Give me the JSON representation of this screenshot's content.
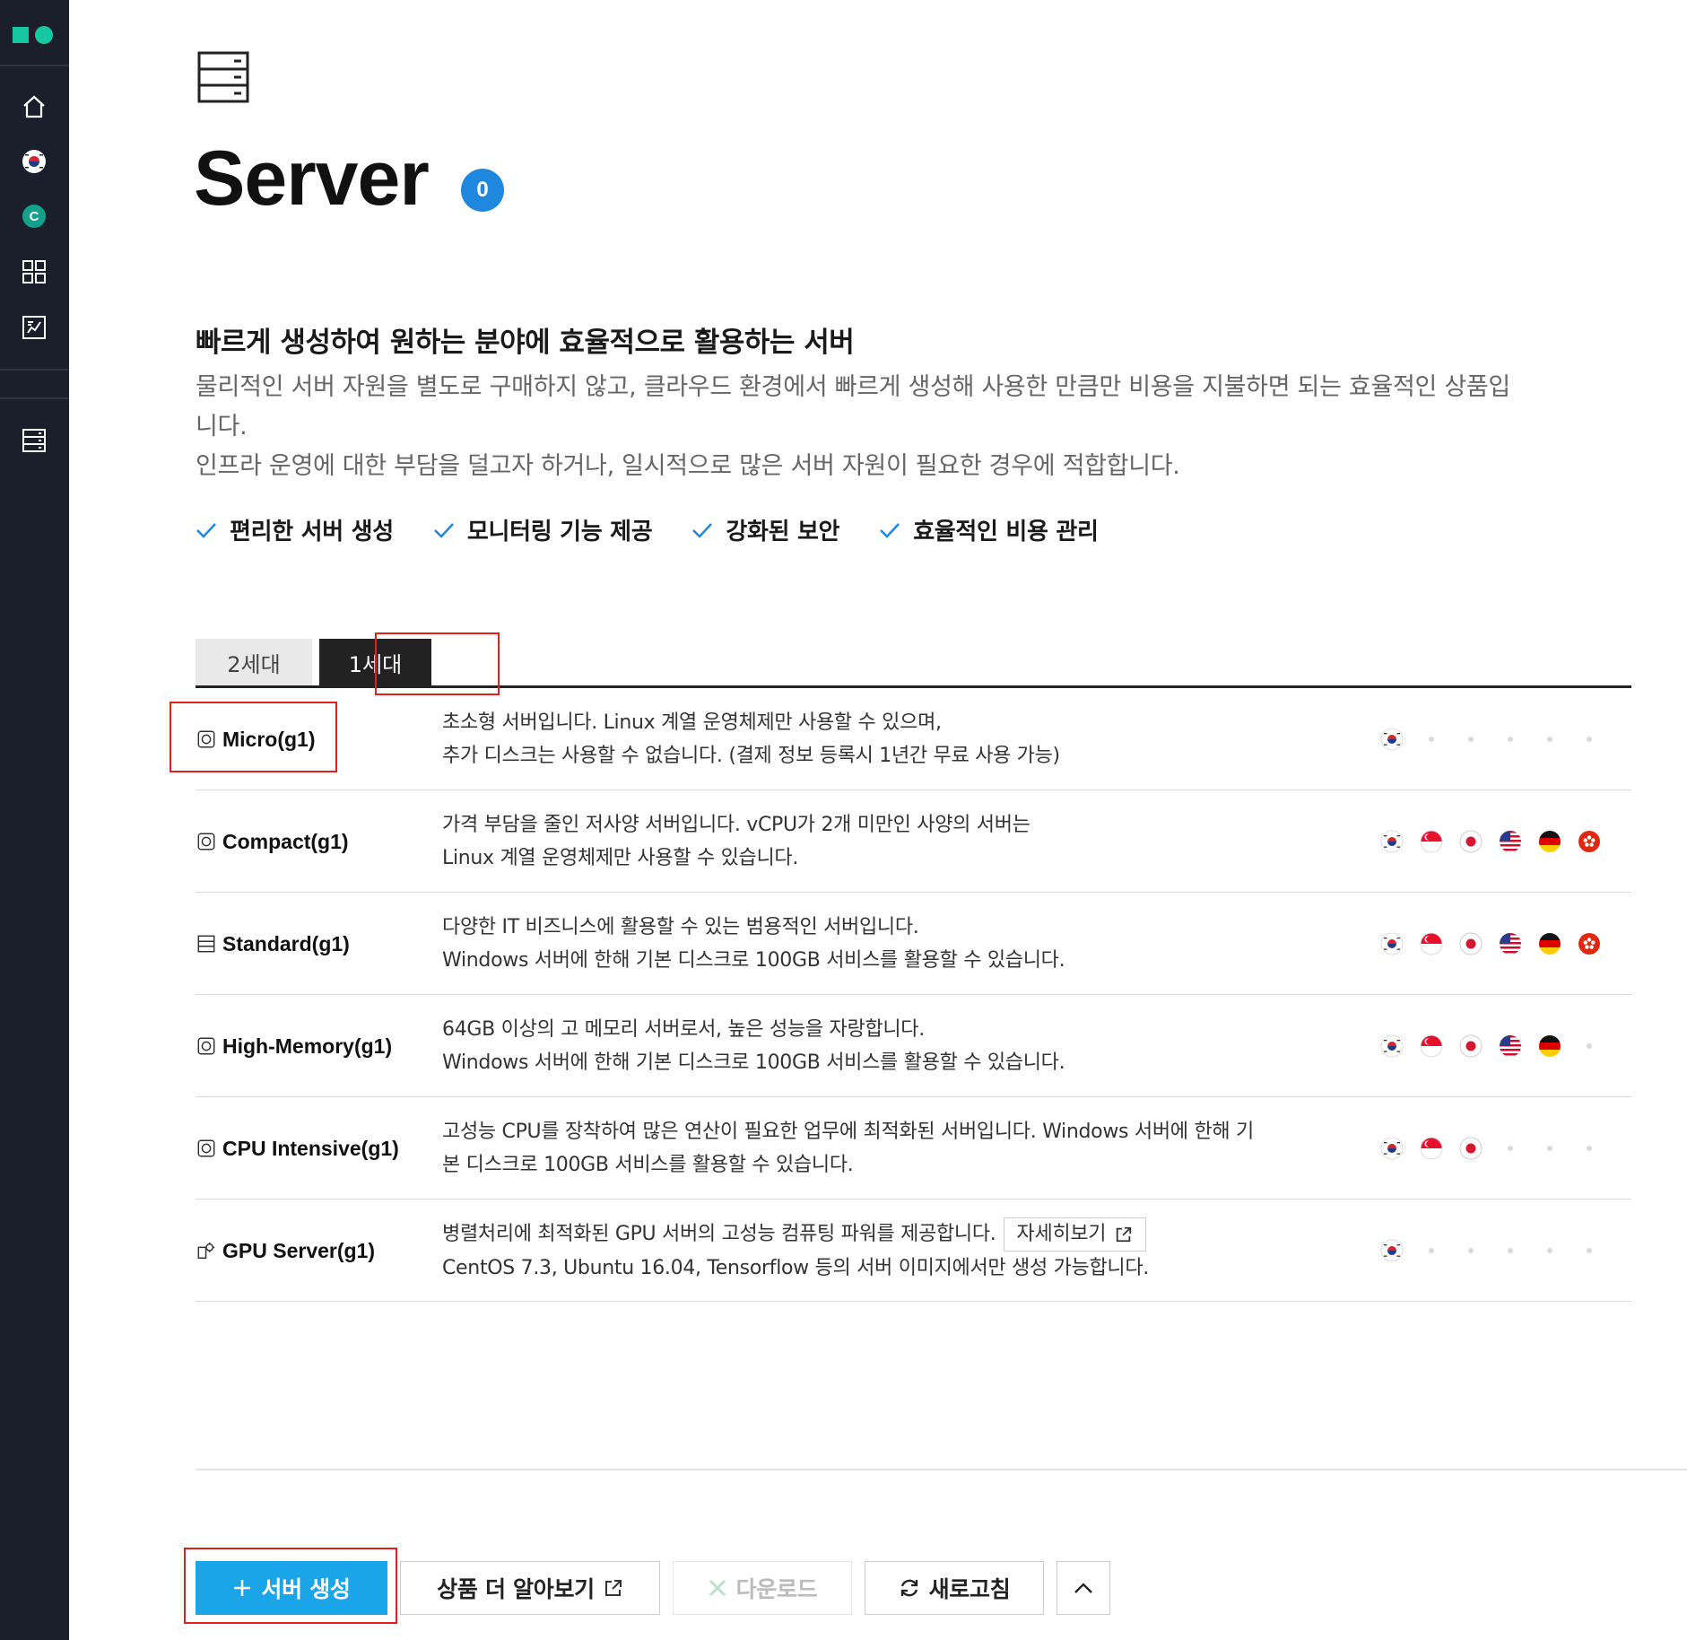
{
  "sidebar": {
    "items": [
      "home-icon",
      "korea-flag-icon",
      "c-badge-icon",
      "grid-icon",
      "dashboard-icon",
      "server-icon"
    ],
    "accent": "#16c7a4",
    "background": "#1b1f2b"
  },
  "header": {
    "title": "Server",
    "count": "0"
  },
  "intro": {
    "subtitle": "빠르게 생성하여 원하는 분야에 효율적으로 활용하는 서버",
    "desc_line1": "물리적인 서버 자원을 별도로 구매하지 않고, 클라우드 환경에서 빠르게 생성해 사용한 만큼만 비용을 지불하면 되는 효율적인 상품입",
    "desc_line2": "니다.",
    "desc_line3": "인프라 운영에 대한 부담을 덜고자 하거나, 일시적으로 많은 서버 자원이 필요한 경우에 적합합니다."
  },
  "features": [
    "편리한 서버 생성",
    "모니터링 기능 제공",
    "강화된 보안",
    "효율적인 비용 관리"
  ],
  "tabs": [
    {
      "label": "2세대",
      "active": false
    },
    {
      "label": "1세대",
      "active": true
    }
  ],
  "products": [
    {
      "name": "Micro(g1)",
      "icon": "smile-server-icon",
      "line1": "초소형 서버입니다. Linux 계열 운영체제만 사용할 수 있으며,",
      "line2": "추가 디스크는 사용할 수 없습니다. (결제 정보 등록시 1년간 무료 사용 가능)",
      "regions": [
        "kr",
        null,
        null,
        null,
        null,
        null
      ]
    },
    {
      "name": "Compact(g1)",
      "icon": "won-server-icon",
      "line1": "가격 부담을 줄인 저사양 서버입니다. vCPU가 2개 미만인 사양의 서버는",
      "line2": "Linux 계열 운영체제만 사용할 수 있습니다.",
      "regions": [
        "kr",
        "sg",
        "jp",
        "us",
        "de",
        "hk"
      ]
    },
    {
      "name": "Standard(g1)",
      "icon": "standard-server-icon",
      "line1": "다양한 IT 비즈니스에 활용할 수 있는 범용적인 서버입니다.",
      "line2": "Windows 서버에 한해 기본 디스크로 100GB 서비스를 활용할 수 있습니다.",
      "regions": [
        "kr",
        "sg",
        "jp",
        "us",
        "de",
        "hk"
      ]
    },
    {
      "name": "High-Memory(g1)",
      "icon": "memory-server-icon",
      "line1": "64GB 이상의 고 메모리 서버로서, 높은 성능을 자랑합니다.",
      "line2": "Windows 서버에 한해 기본 디스크로 100GB 서비스를 활용할 수 있습니다.",
      "regions": [
        "kr",
        "sg",
        "jp",
        "us",
        "de",
        null
      ]
    },
    {
      "name": "CPU Intensive(g1)",
      "icon": "cpu-server-icon",
      "line1": "고성능 CPU를 장착하여 많은 연산이 필요한 업무에 최적화된 서버입니다. Windows 서버에 한해 기",
      "line2": "본 디스크로 100GB 서비스를 활용할 수 있습니다.",
      "regions": [
        "kr",
        "sg",
        "jp",
        null,
        null,
        null
      ]
    },
    {
      "name": "GPU Server(g1)",
      "icon": "gpu-server-icon",
      "line1": "병렬처리에 최적화된 GPU 서버의 고성능 컴퓨팅 파워를 제공합니다.",
      "detail_label": "자세히보기",
      "line2": "CentOS 7.3, Ubuntu 16.04, Tensorflow 등의 서버 이미지에서만 생성 가능합니다.",
      "regions": [
        "kr",
        null,
        null,
        null,
        null,
        null
      ]
    }
  ],
  "actions": {
    "create_label": "서버 생성",
    "learn_label": "상품 더 알아보기",
    "download_label": "다운로드",
    "refresh_label": "새로고침"
  },
  "colors": {
    "primary": "#1aa5e8",
    "badge": "#1f87de",
    "highlight": "#e0201c",
    "check": "#1f87de"
  }
}
